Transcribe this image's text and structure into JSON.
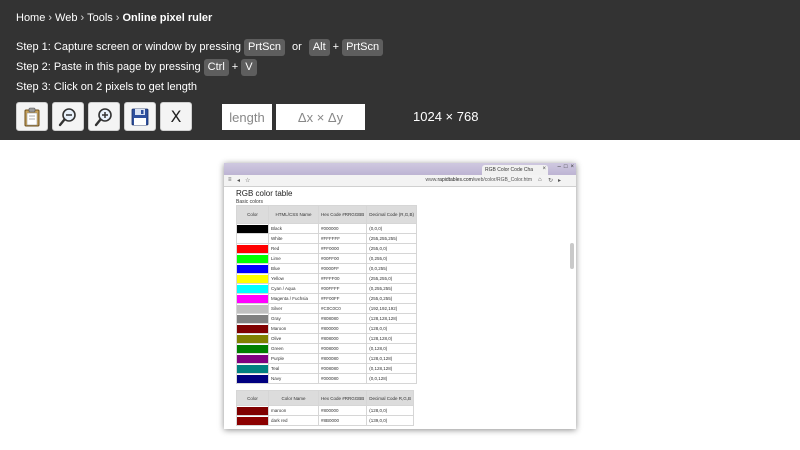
{
  "breadcrumb": [
    {
      "label": "Home"
    },
    {
      "label": "Web"
    },
    {
      "label": "Tools"
    },
    {
      "label": "Online pixel ruler"
    }
  ],
  "separator": "›",
  "steps": {
    "s1_text": "Step 1: Capture screen or window by pressing",
    "s1_key1": "PrtScn",
    "s1_or": "or",
    "s1_key2": "Alt",
    "s1_plus": "+",
    "s1_key3": "PrtScn",
    "s2_text": "Step 2: Paste in this page by pressing",
    "s2_key1": "Ctrl",
    "s2_plus": "+",
    "s2_key2": "V",
    "s3_text": "Step 3: Click on 2 pixels to get length"
  },
  "toolbar": {
    "buttons": [
      "clipboard-icon",
      "zoom-out-icon",
      "zoom-in-icon",
      "save-icon",
      "close-icon"
    ],
    "clear_label": "X"
  },
  "fields": {
    "length_placeholder": "length",
    "delta_placeholder": "Δx × Δy"
  },
  "image_size": "1024 × 768",
  "screenshot": {
    "tab_title": "RGB Color Code Cha",
    "address_prefix": "www.",
    "address_domain": "rapidtables.com",
    "address_path": "/web/color/RGB_Color.htm",
    "page_title": "RGB color table",
    "section_title": "Basic colors",
    "headers": [
      "Color",
      "HTML/CSS Name",
      "Hex Code #RRGGBB",
      "Decimal Code (R,G,B)"
    ],
    "rows": [
      {
        "swatch": "#000000",
        "name": "Black",
        "hex": "#000000",
        "dec": "(0,0,0)"
      },
      {
        "swatch": "#FFFFFF",
        "name": "White",
        "hex": "#FFFFFF",
        "dec": "(255,255,255)"
      },
      {
        "swatch": "#FF0000",
        "name": "Red",
        "hex": "#FF0000",
        "dec": "(255,0,0)"
      },
      {
        "swatch": "#00FF00",
        "name": "Lime",
        "hex": "#00FF00",
        "dec": "(0,255,0)"
      },
      {
        "swatch": "#0000FF",
        "name": "Blue",
        "hex": "#0000FF",
        "dec": "(0,0,255)"
      },
      {
        "swatch": "#FFFF00",
        "name": "Yellow",
        "hex": "#FFFF00",
        "dec": "(255,255,0)"
      },
      {
        "swatch": "#00FFFF",
        "name": "Cyan / Aqua",
        "hex": "#00FFFF",
        "dec": "(0,255,255)"
      },
      {
        "swatch": "#FF00FF",
        "name": "Magenta / Fuchsia",
        "hex": "#FF00FF",
        "dec": "(255,0,255)"
      },
      {
        "swatch": "#C0C0C0",
        "name": "Silver",
        "hex": "#C0C0C0",
        "dec": "(192,192,192)"
      },
      {
        "swatch": "#808080",
        "name": "Gray",
        "hex": "#808080",
        "dec": "(128,128,128)"
      },
      {
        "swatch": "#800000",
        "name": "Maroon",
        "hex": "#800000",
        "dec": "(128,0,0)"
      },
      {
        "swatch": "#808000",
        "name": "Olive",
        "hex": "#808000",
        "dec": "(128,128,0)"
      },
      {
        "swatch": "#008000",
        "name": "Green",
        "hex": "#008000",
        "dec": "(0,128,0)"
      },
      {
        "swatch": "#800080",
        "name": "Purple",
        "hex": "#800080",
        "dec": "(128,0,128)"
      },
      {
        "swatch": "#008080",
        "name": "Teal",
        "hex": "#008080",
        "dec": "(0,128,128)"
      },
      {
        "swatch": "#000080",
        "name": "Navy",
        "hex": "#000080",
        "dec": "(0,0,128)"
      }
    ],
    "headers2": [
      "Color",
      "Color Name",
      "Hex Code #RRGGBB",
      "Decimal Code R,G,B"
    ],
    "rows2": [
      {
        "swatch": "#800000",
        "name": "maroon",
        "hex": "#800000",
        "dec": "(128,0,0)"
      },
      {
        "swatch": "#8B0000",
        "name": "dark red",
        "hex": "#8B0000",
        "dec": "(139,0,0)"
      }
    ]
  },
  "colors": {
    "panel_bg": "#333333",
    "key_bg": "#5e5e5e",
    "text": "#ffffff"
  }
}
